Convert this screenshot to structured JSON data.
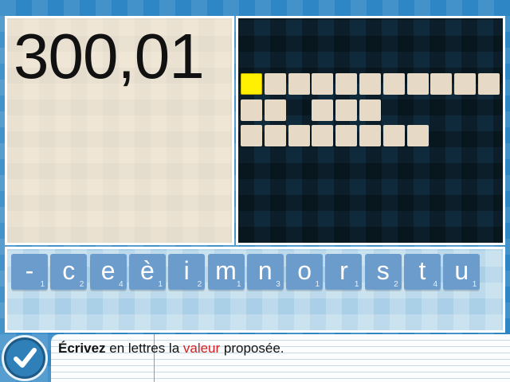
{
  "number_display": "300,01",
  "answer_grid": {
    "rows": [
      11,
      5,
      8
    ],
    "active_cell": 0,
    "gaps": [
      [],
      [
        2
      ],
      []
    ]
  },
  "letter_tiles": [
    {
      "letter": "-",
      "count": "1"
    },
    {
      "letter": "c",
      "count": "2"
    },
    {
      "letter": "e",
      "count": "4"
    },
    {
      "letter": "è",
      "count": "1"
    },
    {
      "letter": "i",
      "count": "2"
    },
    {
      "letter": "m",
      "count": "1"
    },
    {
      "letter": "n",
      "count": "3"
    },
    {
      "letter": "o",
      "count": "1"
    },
    {
      "letter": "r",
      "count": "1"
    },
    {
      "letter": "s",
      "count": "2"
    },
    {
      "letter": "t",
      "count": "4"
    },
    {
      "letter": "u",
      "count": "1"
    }
  ],
  "instruction": {
    "part1": "Écrivez",
    "part2": " en lettres la ",
    "part3": "valeur",
    "part4": " proposée."
  },
  "icons": {
    "validate": "checkmark-icon"
  },
  "colors": {
    "highlight": "#d81d1d",
    "active_cell": "#ffef00",
    "tile": "#6b9ccc"
  }
}
